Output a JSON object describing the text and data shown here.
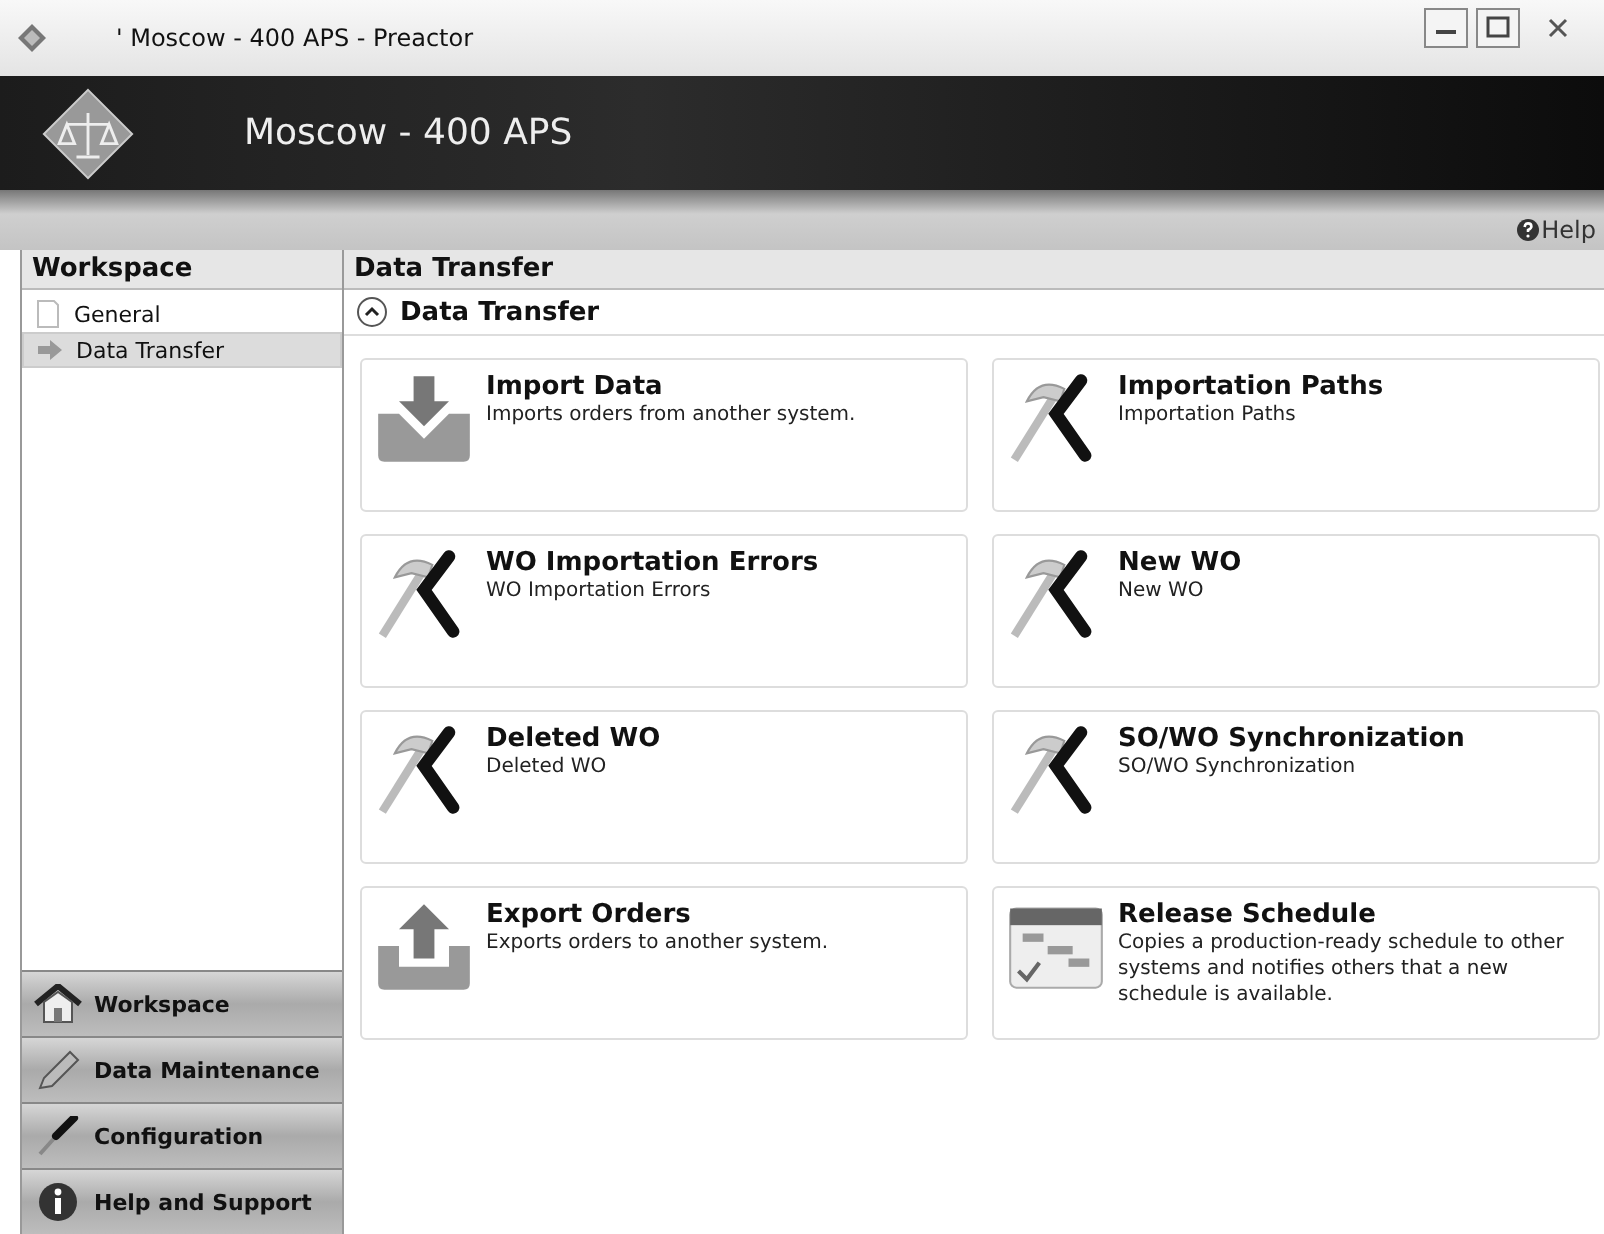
{
  "window": {
    "title": "' Moscow - 400 APS - Preactor"
  },
  "header": {
    "title": "Moscow - 400 APS"
  },
  "toolbar": {
    "help": "Help"
  },
  "sidebar": {
    "title": "Workspace",
    "items": [
      {
        "label": "General",
        "kind": "page",
        "selected": false
      },
      {
        "label": "Data Transfer",
        "kind": "arrow",
        "selected": true
      }
    ],
    "nav": [
      {
        "label": "Workspace",
        "kind": "home"
      },
      {
        "label": "Data Maintenance",
        "kind": "pencil"
      },
      {
        "label": "Configuration",
        "kind": "screwdriver"
      },
      {
        "label": "Help and Support",
        "kind": "info"
      }
    ]
  },
  "main": {
    "title": "Data Transfer",
    "section": {
      "title": "Data Transfer",
      "expanded": true
    },
    "cards": [
      {
        "title": "Import Data",
        "description": "Imports orders from another system.",
        "kind": "import"
      },
      {
        "title": "Importation Paths",
        "description": "Importation Paths",
        "kind": "tools"
      },
      {
        "title": "WO Importation Errors",
        "description": "WO Importation Errors",
        "kind": "tools"
      },
      {
        "title": "New WO",
        "description": "New WO",
        "kind": "tools"
      },
      {
        "title": "Deleted WO",
        "description": "Deleted WO",
        "kind": "tools"
      },
      {
        "title": "SO/WO Synchronization",
        "description": "SO/WO Synchronization",
        "kind": "tools"
      },
      {
        "title": "Export Orders",
        "description": "Exports orders to another system.",
        "kind": "export"
      },
      {
        "title": "Release Schedule",
        "description": "Copies a production-ready schedule to other systems and notifies others that a new schedule is available.",
        "kind": "calendar"
      }
    ]
  }
}
